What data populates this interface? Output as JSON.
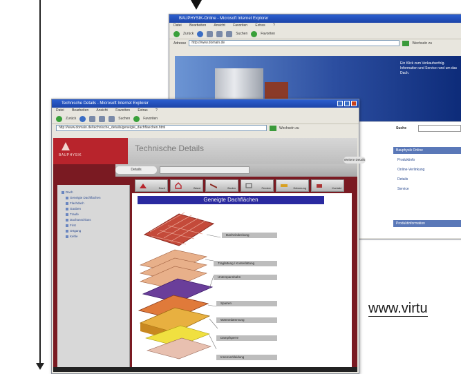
{
  "back_window": {
    "title": "BAUPHYSIK-Online - Microsoft Internet Explorer",
    "menu": [
      "Datei",
      "Bearbeiten",
      "Ansicht",
      "Favoriten",
      "Extras",
      "?"
    ],
    "toolbar": {
      "back": "Zurück",
      "search": "Suchen",
      "favorites": "Favoriten"
    },
    "address": {
      "label": "Adresse",
      "value": "http://www.domain.de",
      "go": "Wechseln zu"
    },
    "hero_text": "Ein Klick zum Verkaufserfolg. Information und Service rund um das Dach.",
    "search_label": "Suche",
    "sidebar_boxes": [
      "Bauphysik Online",
      "Produktinformation"
    ],
    "sidebar_links": [
      "Produktinfo",
      "Online-Verlinkung",
      "Details",
      "Service"
    ]
  },
  "front_window": {
    "title": "Technische Details - Microsoft Internet Explorer",
    "menu": [
      "Datei",
      "Bearbeiten",
      "Ansicht",
      "Favoriten",
      "Extras",
      "?"
    ],
    "toolbar": {
      "back": "Zurück",
      "search": "Suchen",
      "favorites": "Favoriten"
    },
    "address": {
      "value": "http://www.domain.de/technische_details/geneigte_dachflaechen.html",
      "go": "Wechseln zu"
    },
    "logo_text": "BAUPHYSIK",
    "heading": "Technische Details",
    "tag_oval": "Details",
    "tag_right": "Weitere Details",
    "nav_tabs": [
      "Dach",
      "Wand",
      "Boden",
      "Fenster",
      "Dämmung",
      "Kontakt"
    ],
    "sidebar_tree": [
      "Dach",
      "Geneigte Dachflächen",
      "Flachdach",
      "Gauben",
      "Traufe",
      "Dachanschluss",
      "First",
      "Ortgang",
      "Kehle"
    ],
    "section_title": "Geneigte Dachflächen",
    "layers": [
      "Dacheindeckung",
      "Traglattung / Konterlattung",
      "Unterspannbahn",
      "Sparren",
      "Wärmedämmung",
      "Dampfsperre",
      "Innenverkleidung"
    ]
  },
  "website_url": "www.virtu"
}
